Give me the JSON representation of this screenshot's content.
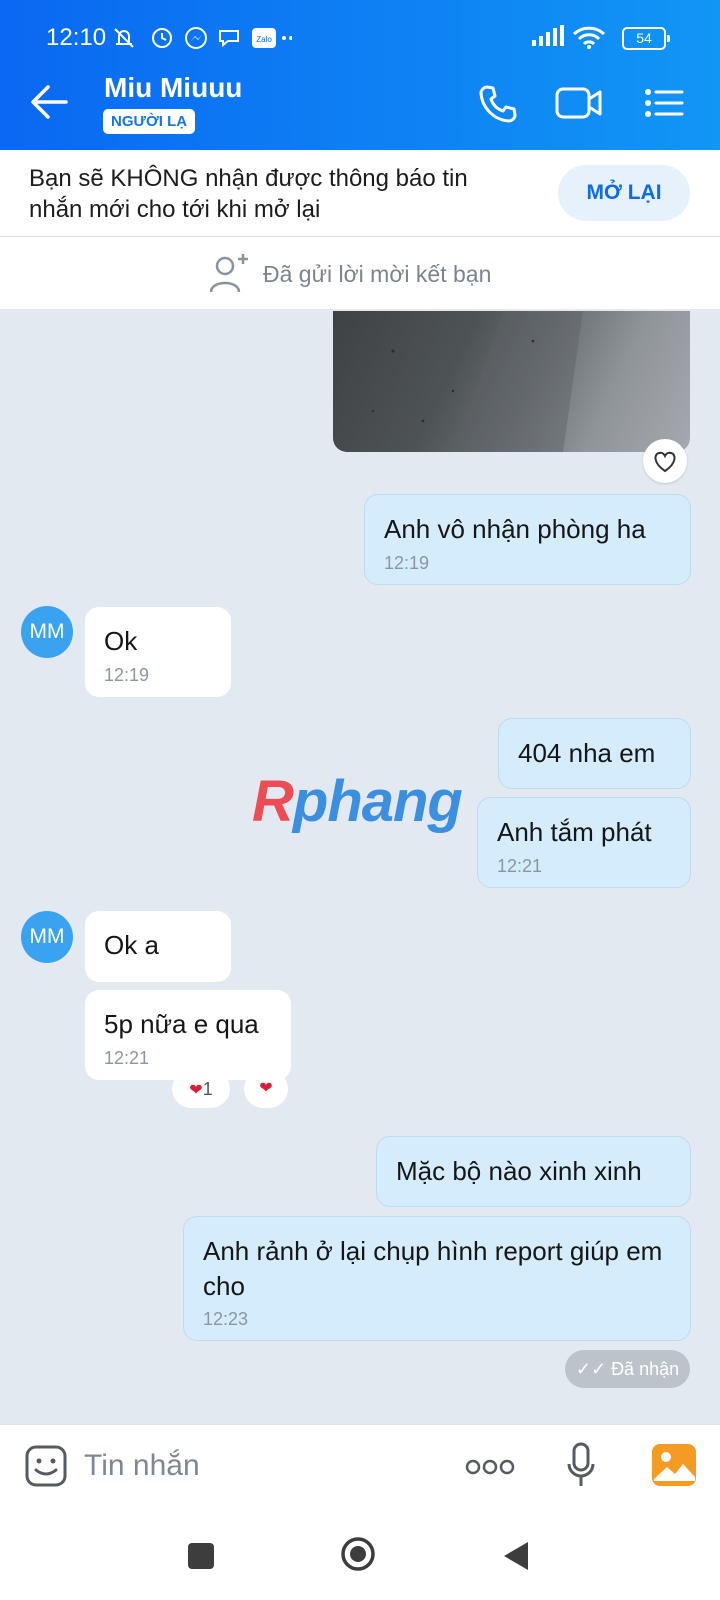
{
  "status_bar": {
    "time": "12:10",
    "battery": "54",
    "app_label": "Zalo"
  },
  "header": {
    "contact_name": "Miu Miuuu",
    "badge": "NGƯỜI LẠ"
  },
  "notice": {
    "text": "Bạn sẽ KHÔNG nhận được thông báo tin nhắn mới cho tới khi mở lại",
    "button": "MỞ LẠI"
  },
  "friend_request": {
    "text": "Đã gửi lời mời kết bạn"
  },
  "avatar_initials": "MM",
  "watermark": {
    "r": "R",
    "rest": "phang"
  },
  "messages": [
    {
      "text": "Anh vô nhận phòng ha",
      "time": "12:19"
    },
    {
      "text": "Ok",
      "time": "12:19"
    },
    {
      "text": "404 nha em"
    },
    {
      "text": "Anh tắm phát",
      "time": "12:21"
    },
    {
      "text": "Ok a"
    },
    {
      "text": "5p nữa e qua",
      "time": "12:21"
    },
    {
      "text": "Mặc bộ nào xinh xinh"
    },
    {
      "text": "Anh rảnh ở lại chụp hình report giúp em cho",
      "time": "12:23"
    }
  ],
  "reactions": {
    "count": "1"
  },
  "delivery_status": "Đã nhận",
  "input": {
    "placeholder": "Tin nhắn"
  },
  "colors": {
    "header_start": "#0a68f2",
    "header_end": "#1196f5",
    "outgoing_bubble": "#d4ecfb",
    "chat_bg": "#e2e9f1"
  }
}
